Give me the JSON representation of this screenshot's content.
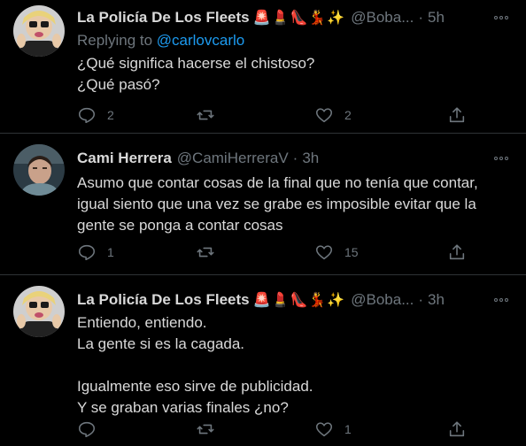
{
  "tweets": [
    {
      "author": "La Policía De Los Fleets",
      "emojis": "🚨💄👠💃✨",
      "handle": "@Boba...",
      "dot": "·",
      "time": "5h",
      "reply_prefix": "Replying to ",
      "reply_mention": "@carlovcarlo",
      "lines": [
        "¿Qué significa hacerse el chistoso?",
        "¿Qué pasó?"
      ],
      "replies": "2",
      "retweets": "",
      "likes": "2"
    },
    {
      "author": "Cami Herrera",
      "emojis": "",
      "handle": "@CamiHerreraV",
      "dot": "·",
      "time": "3h",
      "lines": [
        "Asumo que contar cosas de la final que no tenía que contar,",
        "igual siento que una vez se grabe es imposible evitar que la",
        "gente se ponga a contar cosas"
      ],
      "replies": "1",
      "retweets": "",
      "likes": "15"
    },
    {
      "author": "La Policía De Los Fleets",
      "emojis": "🚨💄👠💃✨",
      "handle": "@Boba...",
      "dot": "·",
      "time": "3h",
      "lines": [
        "Entiendo, entiendo.",
        "La gente si es la cagada.",
        "",
        "Igualmente eso sirve de publicidad.",
        "Y se graban varias finales ¿no?"
      ],
      "replies": "",
      "retweets": "",
      "likes": "1"
    }
  ],
  "colors": {
    "background": "#000000",
    "text": "#d9d9d9",
    "muted": "#6e767d",
    "link": "#1d9bf0",
    "divider": "#2f3336"
  },
  "icons": {
    "reply": "speech-bubble-icon",
    "retweet": "retweet-icon",
    "like": "heart-icon",
    "share": "share-icon",
    "more": "more-dots-icon"
  }
}
